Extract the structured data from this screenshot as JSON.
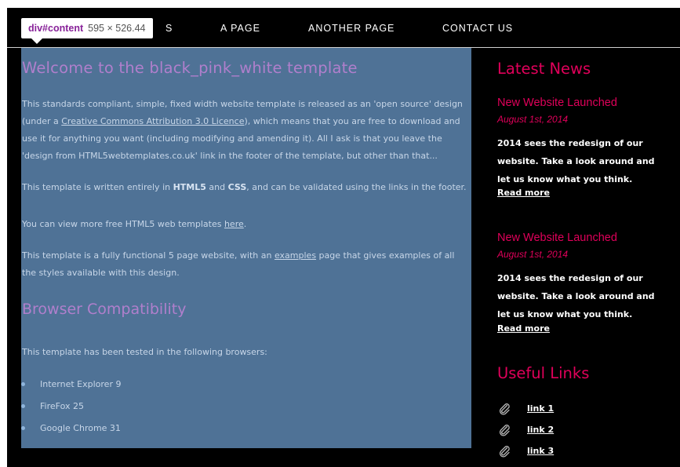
{
  "nav": {
    "items": [
      {
        "label": "S"
      },
      {
        "label": "A PAGE"
      },
      {
        "label": "ANOTHER PAGE"
      },
      {
        "label": "CONTACT US"
      }
    ]
  },
  "devtools": {
    "selector": "div#content",
    "dimensions": "595 × 526.44"
  },
  "content": {
    "title": "Welcome to the black_pink_white template",
    "intro": {
      "before_link": "This standards compliant, simple, fixed width website template is released as an 'open source' design (under a ",
      "link_text": "Creative Commons Attribution 3.0 Licence",
      "after_link": "), which means that you are free to download and use it for anything you want (including modifying and amending it). All I ask is that you leave the 'design from HTML5webtemplates.co.uk' link in the footer of the template, but other than that..."
    },
    "written": {
      "before": "This template is written entirely in ",
      "html5": "HTML5",
      "and": " and ",
      "css": "CSS",
      "after": ", and can be validated using the links in the footer."
    },
    "more": {
      "before": "You can view more free HTML5 web templates ",
      "link_text": "here",
      "after": "."
    },
    "functional": {
      "before": "This template is a fully functional 5 page website, with an ",
      "link_text": "examples",
      "after": " page that gives examples of all the styles available with this design."
    },
    "compat_title": "Browser Compatibility",
    "compat_intro": "This template has been tested in the following browsers:",
    "browsers": [
      "Internet Explorer 9",
      "FireFox 25",
      "Google Chrome 31"
    ]
  },
  "sidebar": {
    "news_heading": "Latest News",
    "news": [
      {
        "title": "New Website Launched",
        "date": "August 1st, 2014",
        "text": "2014 sees the redesign of our website. Take a look around and let us know what you think.",
        "read_more": "Read more"
      },
      {
        "title": "New Website Launched",
        "date": "August 1st, 2014",
        "text": "2014 sees the redesign of our website. Take a look around and let us know what you think.",
        "read_more": "Read more"
      }
    ],
    "links_heading": "Useful Links",
    "links": [
      {
        "label": "link 1",
        "icon": "paperclip-icon"
      },
      {
        "label": "link 2",
        "icon": "paperclip-icon"
      },
      {
        "label": "link 3",
        "icon": "paperclip-icon"
      }
    ]
  },
  "colors": {
    "background": "#000000",
    "content_highlight": "#4f7296",
    "accent_pink": "#e0005a",
    "heading_purple": "#b07fcc"
  }
}
